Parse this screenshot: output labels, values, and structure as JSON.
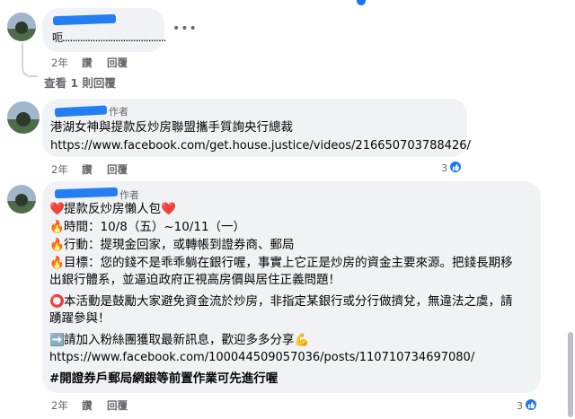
{
  "comments": [
    {
      "text": "呃.........................................",
      "meta": {
        "time": "2年",
        "like": "讚",
        "reply": "回覆"
      },
      "more_icon": "more-dots-icon"
    },
    {
      "author_badge": "作者",
      "text": "港湖女神與提款反炒房聯盟攜手質詢央行總裁",
      "link": "https://www.facebook.com/get.house.justice/videos/216650703788426/",
      "meta": {
        "time": "2年",
        "like": "讚",
        "reply": "回覆"
      },
      "reaction_count": "3"
    },
    {
      "author_badge": "作者",
      "lines": [
        {
          "prefix": "❤️",
          "text": "提款反炒房懶人包",
          "suffix": "❤️"
        },
        {
          "prefix": "🔥",
          "text": "時間：10/8（五）~10/11（一）"
        },
        {
          "prefix": "🔥",
          "text": "行動：提現金回家，或轉帳到證券商、郵局"
        },
        {
          "prefix": "🔥",
          "text": "目標：您的錢不是乖乖躺在銀行喔，事實上它正是炒房的資金主要來源。把錢長期移"
        },
        {
          "text": "出銀行體系，並逼迫政府正視高房價與居住正義問題！"
        },
        {
          "prefix": "⭕",
          "text": "本活動是鼓勵大家避免資金流於炒房，非指定某銀行或分行做擠兌，無違法之虞，請"
        },
        {
          "text": "踴躍參與！"
        },
        {
          "prefix": "➡️",
          "text": "請加入粉絲團獲取最新訊息，歡迎多多分享",
          "suffix": "💪"
        },
        {
          "text": "https://www.facebook.com/100044509057036/posts/110710734697080/"
        },
        {
          "text": "#開證券戶郵局網銀等前置作業可先進行喔"
        }
      ],
      "meta": {
        "time": "2年",
        "like": "讚",
        "reply": "回覆"
      },
      "reaction_count": "3"
    }
  ],
  "view_replies": "查看 1 則回覆",
  "colors": {
    "accent": "#1877f2",
    "bubble": "#f0f2f5",
    "meta": "#65676b"
  }
}
